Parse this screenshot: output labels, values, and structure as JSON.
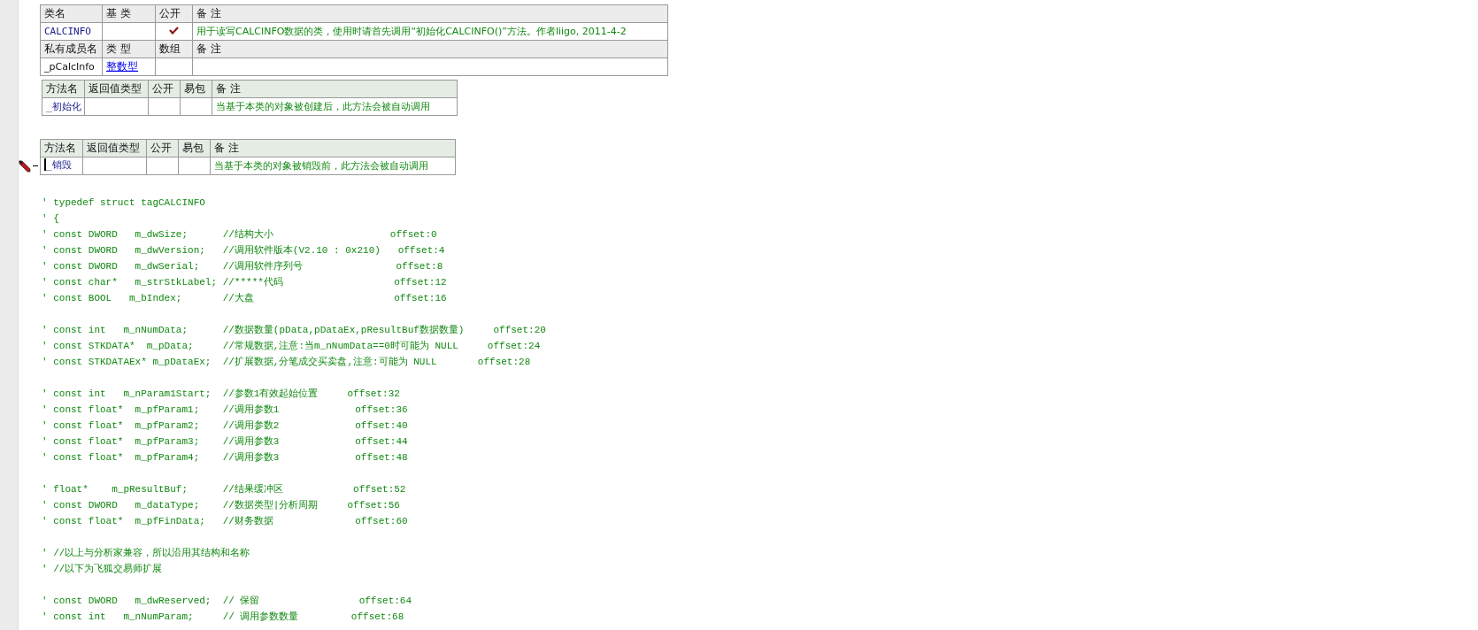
{
  "class_table": {
    "header": [
      "类名",
      "基 类",
      "公开",
      "备 注"
    ],
    "row": {
      "name": "CALCINFO",
      "public": true,
      "note": "用于读写CALCINFO数据的类，使用时请首先调用“初始化CALCINFO()”方法。作者liigo, 2011-4-2"
    },
    "member_header": [
      "私有成员名",
      "类 型",
      "数组",
      "备 注"
    ],
    "members": [
      {
        "name": "_pCalcInfo",
        "type": "整数型",
        "array": false
      }
    ]
  },
  "methods": [
    {
      "header": [
        "方法名",
        "返回值类型",
        "公开",
        "易包"
      ],
      "note_header": "备 注",
      "name": "_初始化",
      "public": false,
      "easy_pack": false,
      "note": "当基于本类的对象被创建后，此方法会被自动调用",
      "editing": false
    },
    {
      "header": [
        "方法名",
        "返回值类型",
        "公开",
        "易包"
      ],
      "note_header": "备 注",
      "name": "_销毁",
      "public": false,
      "easy_pack": false,
      "note": "当基于本类的对象被销毁前，此方法会被自动调用",
      "editing": true
    }
  ],
  "code_blocks": [
    [
      "' typedef struct tagCALCINFO",
      "' {",
      "' const DWORD   m_dwSize;      //结构大小                    offset:0",
      "' const DWORD   m_dwVersion;   //调用软件版本(V2.10 : 0x210)   offset:4",
      "' const DWORD   m_dwSerial;    //调用软件序列号                offset:8",
      "' const char*   m_strStkLabel; //*****代码                   offset:12",
      "' const BOOL   m_bIndex;       //大盘                        offset:16"
    ],
    [
      "' const int   m_nNumData;      //数据数量(pData,pDataEx,pResultBuf数据数量)     offset:20",
      "' const STKDATA*  m_pData;     //常规数据,注意:当m_nNumData==0时可能为 NULL     offset:24",
      "' const STKDATAEx* m_pDataEx;  //扩展数据,分笔成交买卖盘,注意:可能为 NULL       offset:28"
    ],
    [
      "' const int   m_nParam1Start;  //参数1有效起始位置     offset:32",
      "' const float*  m_pfParam1;    //调用参数1             offset:36",
      "' const float*  m_pfParam2;    //调用参数2             offset:40",
      "' const float*  m_pfParam3;    //调用参数3             offset:44",
      "' const float*  m_pfParam4;    //调用参数3             offset:48"
    ],
    [
      "' float*    m_pResultBuf;      //结果缓冲区            offset:52",
      "' const DWORD   m_dataType;    //数据类型|分析周期     offset:56",
      "' const float*  m_pfFinData;   //财务数据              offset:60"
    ],
    [
      "' //以上与分析家兼容，所以沿用其结构和名称",
      "' //以下为飞狐交易师扩展"
    ],
    [
      "' const DWORD   m_dwReserved;  // 保留                 offset:64",
      "' const int   m_nNumParam;     // 调用参数数量         offset:68"
    ]
  ]
}
